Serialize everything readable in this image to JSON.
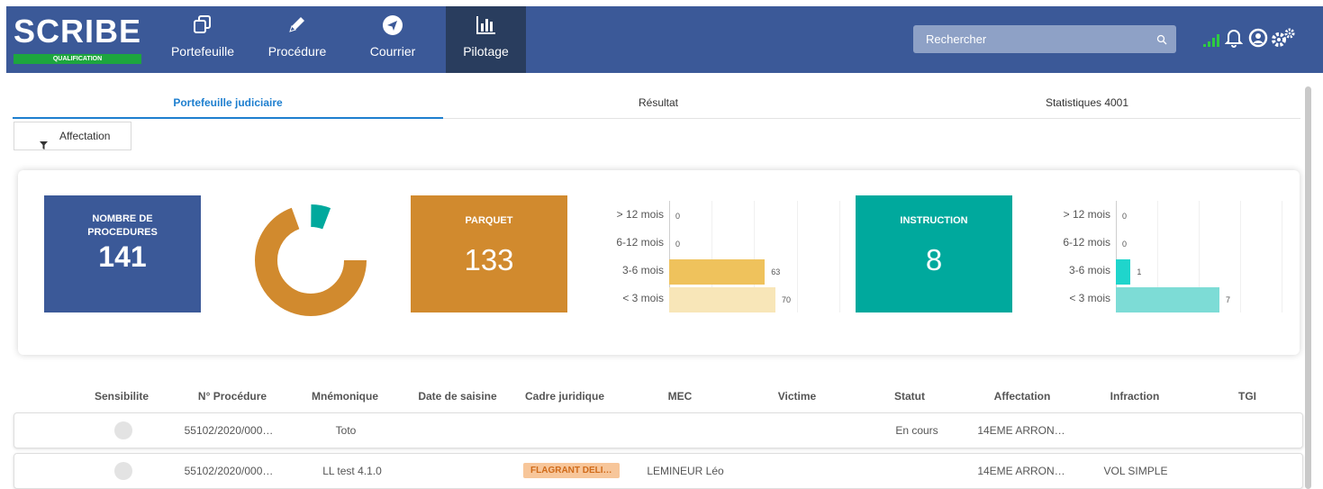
{
  "app": {
    "name": "SCRIBE",
    "env_badge": "QUALIFICATION"
  },
  "nav": [
    {
      "label": "Portefeuille",
      "icon": "copy-icon"
    },
    {
      "label": "Procédure",
      "icon": "pencil-icon"
    },
    {
      "label": "Courrier",
      "icon": "send-icon"
    },
    {
      "label": "Pilotage",
      "icon": "bar-chart-icon",
      "active": true
    }
  ],
  "search": {
    "placeholder": "Rechercher"
  },
  "header_icons": [
    "signal-icon",
    "bell-icon",
    "user-icon",
    "settings-icon"
  ],
  "tabs": [
    {
      "label": "Portefeuille judiciaire",
      "active": true
    },
    {
      "label": "Résultat"
    },
    {
      "label": "Statistiques 4001"
    }
  ],
  "filter": {
    "label": "Affectation"
  },
  "stats": {
    "total": {
      "title_line1": "NOMBRE DE",
      "title_line2": "PROCEDURES",
      "value": "141",
      "color": "#3b5998"
    },
    "parquet": {
      "title": "PARQUET",
      "value": "133",
      "color": "#d18a2e"
    },
    "instruction": {
      "title": "INSTRUCTION",
      "value": "8",
      "color": "#00a99d"
    }
  },
  "chart_data": [
    {
      "type": "pie",
      "categories": [
        "PARQUET",
        "INSTRUCTION"
      ],
      "values": [
        133,
        8
      ],
      "colors": [
        "#d18a2e",
        "#00a99d"
      ],
      "donut": true
    },
    {
      "type": "bar",
      "orientation": "horizontal",
      "categories": [
        "> 12 mois",
        "6-12 mois",
        "3-6 mois",
        "< 3 mois"
      ],
      "values": [
        0,
        0,
        63,
        70
      ],
      "colors": [
        "#efc25c",
        "#efc25c",
        "#efc25c",
        "#f8e6b8"
      ],
      "xlim": [
        0,
        140
      ]
    },
    {
      "type": "bar",
      "orientation": "horizontal",
      "categories": [
        "> 12 mois",
        "6-12 mois",
        "3-6 mois",
        "< 3 mois"
      ],
      "values": [
        0,
        0,
        1,
        7
      ],
      "colors": [
        "#1fd5cc",
        "#1fd5cc",
        "#1fd5cc",
        "#7ddcd6"
      ],
      "xlim": [
        0,
        14
      ]
    }
  ],
  "table": {
    "columns": [
      "Sensibilite",
      "N° Procédure",
      "Mnémonique",
      "Date de saisine",
      "Cadre juridique",
      "MEC",
      "Victime",
      "Statut",
      "Affectation",
      "Infraction",
      "TGI"
    ],
    "rows": [
      {
        "procedure": "55102/2020/000…",
        "mnemonique": "Toto",
        "date": "",
        "cadre": "",
        "mec": "",
        "victime": "",
        "statut": "En cours",
        "affectation": "14EME ARRON…",
        "infraction": "",
        "tgi": ""
      },
      {
        "procedure": "55102/2020/000…",
        "mnemonique": "LL test 4.1.0",
        "date": "",
        "cadre": "FLAGRANT DELI…",
        "mec": "LEMINEUR Léo",
        "victime": "",
        "statut": "",
        "affectation": "14EME ARRON…",
        "infraction": "VOL SIMPLE",
        "tgi": ""
      }
    ]
  }
}
